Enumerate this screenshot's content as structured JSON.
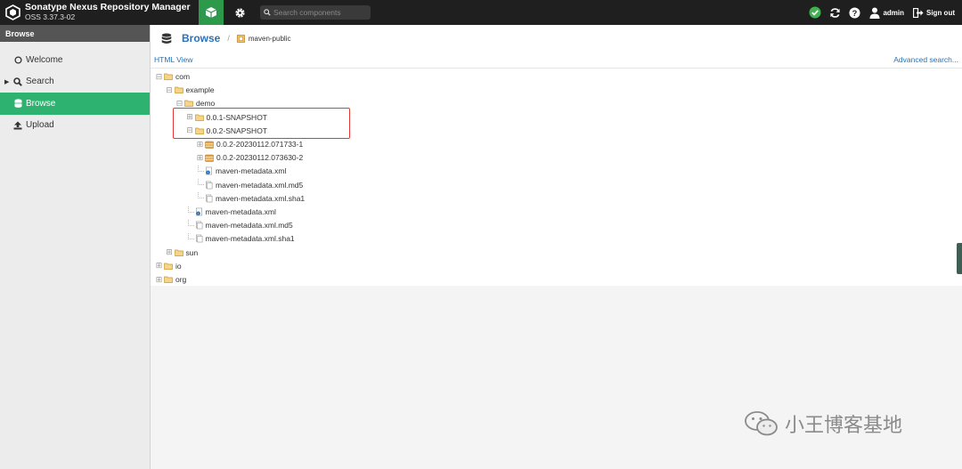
{
  "topbar": {
    "app_title": "Sonatype Nexus Repository Manager",
    "version": "OSS 3.37.3-02",
    "search_placeholder": "Search components",
    "user": "admin",
    "signout": "Sign out"
  },
  "sidebar": {
    "header": "Browse",
    "items": [
      {
        "label": "Welcome",
        "icon": "circle-icon"
      },
      {
        "label": "Search",
        "icon": "search-icon"
      },
      {
        "label": "Browse",
        "icon": "database-icon"
      },
      {
        "label": "Upload",
        "icon": "upload-icon"
      }
    ]
  },
  "breadcrumb": {
    "title": "Browse",
    "separator": "/",
    "repo": "maven-public"
  },
  "toolbar": {
    "html_view": "HTML View",
    "advanced_search": "Advanced search..."
  },
  "tree": [
    {
      "label": "com",
      "type": "folder",
      "depth": 0,
      "expanded": true
    },
    {
      "label": "example",
      "type": "folder",
      "depth": 1,
      "expanded": true
    },
    {
      "label": "demo",
      "type": "folder",
      "depth": 2,
      "expanded": true
    },
    {
      "label": "0.0.1-SNAPSHOT",
      "type": "folder",
      "depth": 3,
      "expanded": false
    },
    {
      "label": "0.0.2-SNAPSHOT",
      "type": "folder",
      "depth": 3,
      "expanded": true
    },
    {
      "label": "0.0.2-20230112.071733-1",
      "type": "component",
      "depth": 4,
      "expanded": false
    },
    {
      "label": "0.0.2-20230112.073630-2",
      "type": "component",
      "depth": 4,
      "expanded": false
    },
    {
      "label": "maven-metadata.xml",
      "type": "metadata",
      "depth": 4
    },
    {
      "label": "maven-metadata.xml.md5",
      "type": "file",
      "depth": 4
    },
    {
      "label": "maven-metadata.xml.sha1",
      "type": "file",
      "depth": 4
    },
    {
      "label": "maven-metadata.xml",
      "type": "metadata",
      "depth": 3
    },
    {
      "label": "maven-metadata.xml.md5",
      "type": "file",
      "depth": 3
    },
    {
      "label": "maven-metadata.xml.sha1",
      "type": "file",
      "depth": 3
    },
    {
      "label": "sun",
      "type": "folder",
      "depth": 1,
      "expanded": false
    },
    {
      "label": "io",
      "type": "folder",
      "depth": 0,
      "expanded": false
    },
    {
      "label": "org",
      "type": "folder",
      "depth": 0,
      "expanded": false
    }
  ],
  "watermark": "小王博客基地",
  "colors": {
    "topbar": "#1f1f1f",
    "accent_green": "#2db36f",
    "link_blue": "#2a72b5",
    "highlight_red": "#e53935",
    "folder_yellow": "#f0c04a"
  }
}
